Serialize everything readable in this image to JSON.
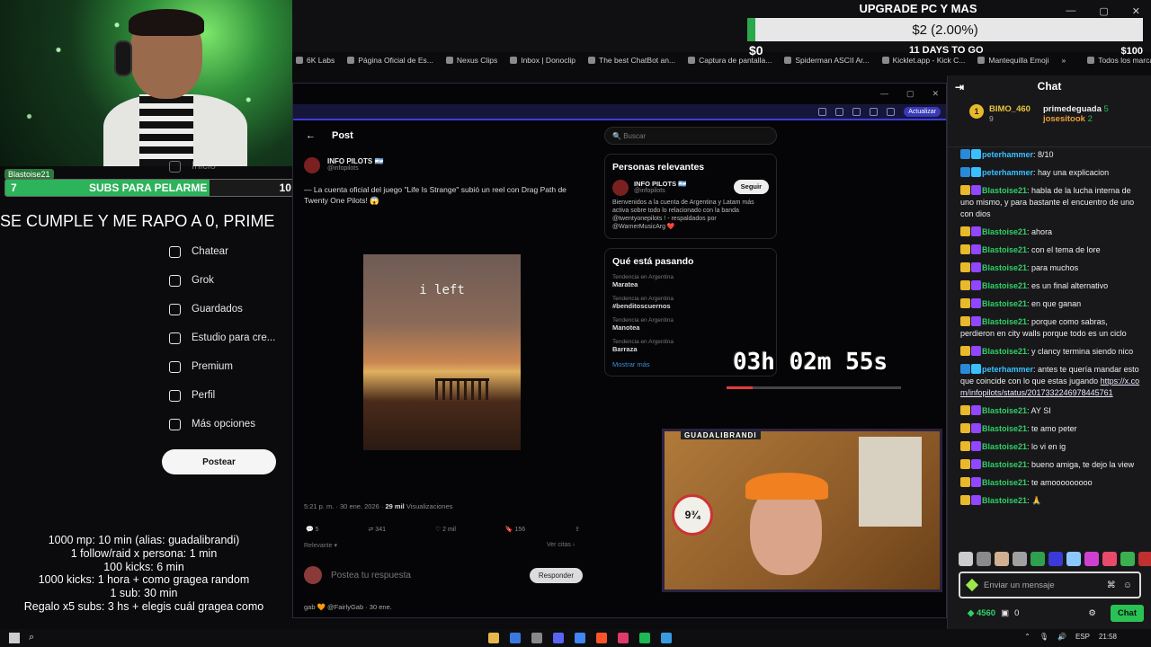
{
  "webcam_overlay": {
    "subs_goal_count": "7",
    "subs_goal_label": "SUBS PARA PELARME",
    "subs_goal_total": "10",
    "subs_goal_progress": 0.7,
    "badge": "Blastoise21",
    "ticker": "SE CUMPLE Y ME RAPO A 0, PRIME"
  },
  "donation_goal": {
    "title": "UPGRADE PC Y MAS",
    "amount": "$2 (2.00%)",
    "progress": 0.02,
    "min": "$0",
    "max": "$100",
    "days_left": "11 DAYS TO GO"
  },
  "bookmarks": [
    "6K Labs",
    "Página Oficial de Es...",
    "Nexus Clips",
    "Inbox | Donoclip",
    "The best ChatBot an...",
    "Captura de pantalla...",
    "Spiderman ASCII Ar...",
    "Kicklet.app - Kick C...",
    "Mantequilla Emoji",
    "»",
    "Todos los marcadores"
  ],
  "left_nav": [
    "Inicio",
    "Chatear",
    "Grok",
    "Guardados",
    "Estudio para cre...",
    "Premium",
    "Perfil",
    "Más opciones"
  ],
  "left_nav_icons": [
    "home-icon",
    "chat-icon",
    "grok-icon",
    "bookmark-icon",
    "studio-icon",
    "x-icon",
    "profile-icon",
    "more-icon"
  ],
  "post_button": "Postear",
  "rules": [
    "1000 mp: 10 min (alias: guadalibrandi)",
    "1 follow/raid x persona: 1 min",
    "100 kicks: 6 min",
    "1000 kicks: 1 hora + como gragea random",
    "1 sub: 30 min",
    "Regalo x5 subs: 3 hs + elegis cuál gragea como"
  ],
  "inner_browser": {
    "update_label": "Actualizar"
  },
  "post": {
    "header": "Post",
    "author_name": "INFO PILOTS 🇦🇷",
    "author_handle": "@infopilots",
    "text": "— La cuenta oficial del juego \"Life Is Strange\" subió un reel con Drag Path de Twenty One Pilots! 😱",
    "media_caption": "i left",
    "meta_time": "5:21 p. m. · 30 ene. 2026 · ",
    "meta_views": "29 mil",
    "meta_views_label": " Visualizaciones",
    "actions": [
      "5",
      "341",
      "2 mil",
      "156",
      ""
    ],
    "relevance": "Relevante ▾",
    "quotes": "Ver citas ›",
    "reply_placeholder": "Postea tu respuesta",
    "reply_button": "Responder",
    "next_reply": "gab 🧡 @FairlyGab · 30 ene."
  },
  "right_column": {
    "search_placeholder": "Buscar",
    "relevant_title": "Personas relevantes",
    "relevant_name": "INFO PILOTS 🇦🇷",
    "relevant_handle": "@infopilots",
    "relevant_bio": "Bienvenidos a la cuenta de Argentina y Latam más activa sobre todo lo relacionado con la banda @twentyonepilots ! - respaldados por @WarnerMusicArg ❤️",
    "follow_label": "Seguir",
    "trending_title": "Qué está pasando",
    "trends": [
      {
        "ctx": "Tendencia en Argentina",
        "name": "Maratea"
      },
      {
        "ctx": "Tendencia en Argentina",
        "name": "#benditoscuernos"
      },
      {
        "ctx": "Tendencia en Argentina",
        "name": "Manotea"
      },
      {
        "ctx": "Tendencia en Argentina",
        "name": "Barraza"
      }
    ],
    "show_more": "Mostrar más"
  },
  "timer": {
    "text": "03h 02m 55s",
    "progress": 0.15
  },
  "cam2": {
    "label": "GUADALIBRANDI",
    "platform": "9¾"
  },
  "chat": {
    "header": "Chat",
    "leaderboard": [
      {
        "rank": "1",
        "user": "BIMO_460",
        "count": "9"
      },
      {
        "user": "primedeguada",
        "count": "5"
      },
      {
        "user": "josesitook",
        "count": "2"
      }
    ],
    "messages": [
      {
        "user": "peterhammer",
        "text": " 8/10",
        "color": "#3ac0ff"
      },
      {
        "user": "peterhammer",
        "text": " hay una explicacion",
        "color": "#3ac0ff"
      },
      {
        "user": "Blastoise21",
        "text": " habla de la lucha interna de uno mismo, y para bastante el encuentro de uno con dios",
        "color": "#2fd165"
      },
      {
        "user": "Blastoise21",
        "text": " ahora",
        "color": "#2fd165"
      },
      {
        "user": "Blastoise21",
        "text": " con el tema de lore",
        "color": "#2fd165"
      },
      {
        "user": "Blastoise21",
        "text": " para muchos",
        "color": "#2fd165"
      },
      {
        "user": "Blastoise21",
        "text": " es un final alternativo",
        "color": "#2fd165"
      },
      {
        "user": "Blastoise21",
        "text": " en que ganan",
        "color": "#2fd165"
      },
      {
        "user": "Blastoise21",
        "text": " porque como sabras, perdieron en city walls porque todo es un ciclo",
        "color": "#2fd165"
      },
      {
        "user": "Blastoise21",
        "text": " y clancy termina siendo nico",
        "color": "#2fd165"
      },
      {
        "user": "peterhammer",
        "text": " antes te quería mandar esto que coincide con lo que estas jugando ",
        "link": "https://x.com/infopilots/status/2017332246978445761",
        "color": "#3ac0ff"
      },
      {
        "user": "Blastoise21",
        "text": " AY SI",
        "color": "#2fd165"
      },
      {
        "user": "Blastoise21",
        "text": " te amo peter",
        "color": "#2fd165"
      },
      {
        "user": "Blastoise21",
        "text": " lo vi en ig",
        "color": "#2fd165"
      },
      {
        "user": "Blastoise21",
        "text": " bueno amiga, te dejo la view",
        "color": "#2fd165"
      },
      {
        "user": "Blastoise21",
        "text": " te amooooooooo",
        "color": "#2fd165"
      },
      {
        "user": "Blastoise21",
        "text": " 🙏",
        "color": "#2fd165"
      }
    ],
    "input_placeholder": "Enviar un mensaje",
    "points": "4560",
    "drops": "0",
    "send_label": "Chat"
  },
  "taskbar": {
    "lang": "ESP",
    "time": "21:58"
  }
}
